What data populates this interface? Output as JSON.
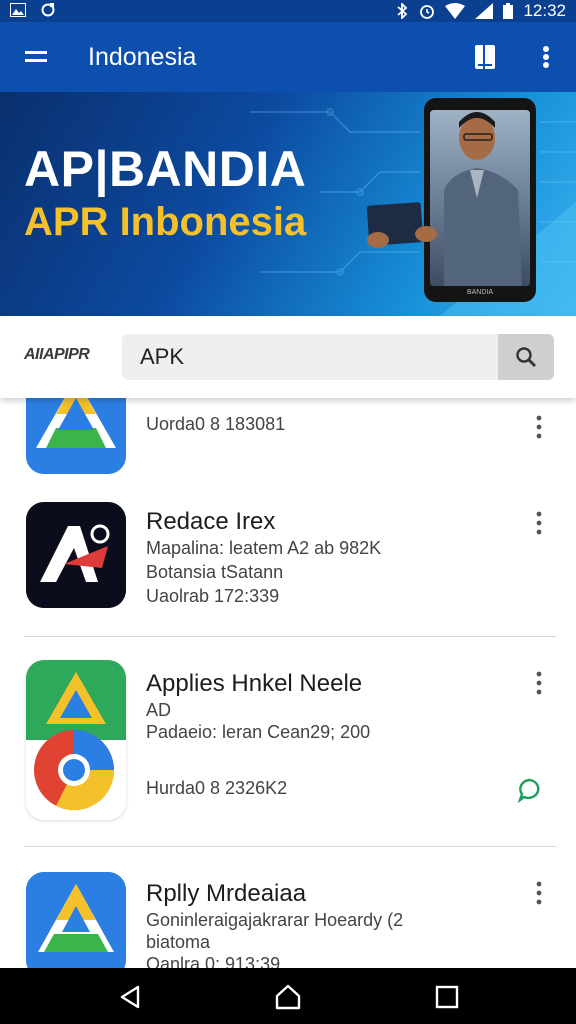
{
  "status_bar": {
    "time": "12:32",
    "left_icons": [
      "image-icon",
      "sync-icon"
    ],
    "right_icons": [
      "bluetooth-icon",
      "alarm-icon",
      "wifi-icon",
      "signal-icon",
      "battery-icon"
    ]
  },
  "app_bar": {
    "title": "Indonesia",
    "icons": [
      "menu-icon",
      "book-icon",
      "more-vert-icon"
    ]
  },
  "banner": {
    "headline": "AP|BANDIA",
    "subheadline": "APR Inbonesia",
    "phone_label": "BANDIA"
  },
  "search": {
    "brand": "AIIAPIPR",
    "value": "APK",
    "button_icon": "search-icon"
  },
  "apps": [
    {
      "name": "",
      "lines": [
        "Uorda0 8 183081"
      ],
      "icon": "drive-blue-icon"
    },
    {
      "name": "Redace Irex",
      "lines": [
        "Mapalina: leatem A2 ab 982K",
        "Botansia tSatann",
        "Uaolrab 172:339"
      ],
      "icon": "a-letter-dark-icon"
    },
    {
      "name": "Applies Hnkel Neele",
      "lines": [
        "AD",
        "Padaeio: leran Cean29; 200",
        "Hurda0 8 2326K2"
      ],
      "icon": "drive-chrome-combo-icon",
      "badge_icon": "chat-bubble-icon"
    },
    {
      "name": "Rplly Mrdeaiaa",
      "lines": [
        "Goninleraigajakrarar Hoeardy (2",
        "biatoma",
        "Oanlra 0; 913:39"
      ],
      "icon": "drive-blue-icon"
    }
  ],
  "nav_bar": {
    "icons": [
      "back-icon",
      "home-icon",
      "recents-icon"
    ]
  },
  "colors": {
    "status_bar": "#0b3f8f",
    "app_bar": "#0d4fae",
    "banner_headline": "#ffffff",
    "banner_subheadline": "#f4c12b",
    "accent_green": "#1e9c5a"
  }
}
